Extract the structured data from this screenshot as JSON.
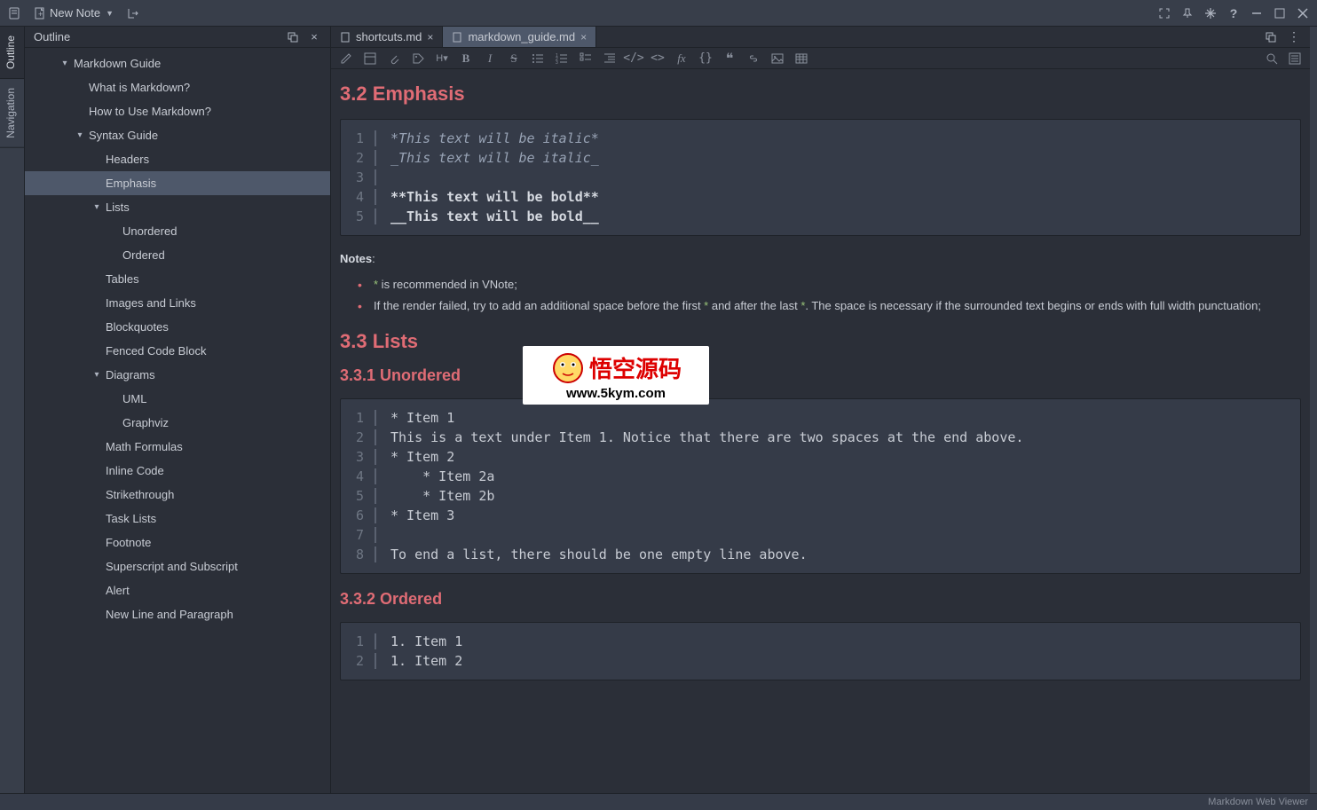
{
  "titlebar": {
    "new_note": "New Note"
  },
  "sidebar": {
    "title": "Outline",
    "tabs": {
      "outline": "Outline",
      "navigation": "Navigation"
    },
    "tree": [
      {
        "label": "Markdown Guide",
        "indent": 0,
        "caret": "down",
        "selected": false
      },
      {
        "label": "What is Markdown?",
        "indent": 1,
        "caret": "none",
        "selected": false
      },
      {
        "label": "How to Use Markdown?",
        "indent": 1,
        "caret": "none",
        "selected": false
      },
      {
        "label": "Syntax Guide",
        "indent": 1,
        "caret": "down",
        "selected": false
      },
      {
        "label": "Headers",
        "indent": 2,
        "caret": "none",
        "selected": false
      },
      {
        "label": "Emphasis",
        "indent": 2,
        "caret": "none",
        "selected": true
      },
      {
        "label": "Lists",
        "indent": 2,
        "caret": "down",
        "selected": false
      },
      {
        "label": "Unordered",
        "indent": 3,
        "caret": "none",
        "selected": false
      },
      {
        "label": "Ordered",
        "indent": 3,
        "caret": "none",
        "selected": false
      },
      {
        "label": "Tables",
        "indent": 2,
        "caret": "none",
        "selected": false
      },
      {
        "label": "Images and Links",
        "indent": 2,
        "caret": "none",
        "selected": false
      },
      {
        "label": "Blockquotes",
        "indent": 2,
        "caret": "none",
        "selected": false
      },
      {
        "label": "Fenced Code Block",
        "indent": 2,
        "caret": "none",
        "selected": false
      },
      {
        "label": "Diagrams",
        "indent": 2,
        "caret": "down",
        "selected": false
      },
      {
        "label": "UML",
        "indent": 3,
        "caret": "none",
        "selected": false
      },
      {
        "label": "Graphviz",
        "indent": 3,
        "caret": "none",
        "selected": false
      },
      {
        "label": "Math Formulas",
        "indent": 2,
        "caret": "none",
        "selected": false
      },
      {
        "label": "Inline Code",
        "indent": 2,
        "caret": "none",
        "selected": false
      },
      {
        "label": "Strikethrough",
        "indent": 2,
        "caret": "none",
        "selected": false
      },
      {
        "label": "Task Lists",
        "indent": 2,
        "caret": "none",
        "selected": false
      },
      {
        "label": "Footnote",
        "indent": 2,
        "caret": "none",
        "selected": false
      },
      {
        "label": "Superscript and Subscript",
        "indent": 2,
        "caret": "none",
        "selected": false
      },
      {
        "label": "Alert",
        "indent": 2,
        "caret": "none",
        "selected": false
      },
      {
        "label": "New Line and Paragraph",
        "indent": 2,
        "caret": "none",
        "selected": false
      }
    ]
  },
  "tabs": [
    {
      "name": "shortcuts.md",
      "active": false
    },
    {
      "name": "markdown_guide.md",
      "active": true
    }
  ],
  "content": {
    "h32": "3.2 Emphasis",
    "code1": [
      {
        "n": "1",
        "t": "*This text will be italic*",
        "style": "italic"
      },
      {
        "n": "2",
        "t": "_This text will be italic_",
        "style": "italic"
      },
      {
        "n": "3",
        "t": "",
        "style": ""
      },
      {
        "n": "4",
        "t": "**This text will be bold**",
        "style": "bold"
      },
      {
        "n": "5",
        "t": "__This text will be bold__",
        "style": "bold"
      }
    ],
    "notes_label": "Notes",
    "notes_colon": ":",
    "note1_ast": "*",
    "note1_rest": " is recommended in VNote;",
    "note2_pre": "If the render failed, try to add an additional space before the first ",
    "note2_ast1": "*",
    "note2_mid": " and after the last ",
    "note2_ast2": "*",
    "note2_post": ". The space is necessary if the surrounded text begins or ends with full width punctuation;",
    "h33": "3.3 Lists",
    "h331": "3.3.1 Unordered",
    "code2": [
      {
        "n": "1",
        "t": "* Item 1"
      },
      {
        "n": "2",
        "t": "This is a text under Item 1. Notice that there are two spaces at the end above."
      },
      {
        "n": "3",
        "t": "* Item 2"
      },
      {
        "n": "4",
        "t": "    * Item 2a"
      },
      {
        "n": "5",
        "t": "    * Item 2b"
      },
      {
        "n": "6",
        "t": "* Item 3"
      },
      {
        "n": "7",
        "t": ""
      },
      {
        "n": "8",
        "t": "To end a list, there should be one empty line above."
      }
    ],
    "h332": "3.3.2 Ordered",
    "code3": [
      {
        "n": "1",
        "t": "1. Item 1"
      },
      {
        "n": "2",
        "t": "1. Item 2"
      }
    ]
  },
  "watermark": {
    "text": "悟空源码",
    "url": "www.5kym.com"
  },
  "footer": {
    "status": "Markdown Web Viewer"
  }
}
